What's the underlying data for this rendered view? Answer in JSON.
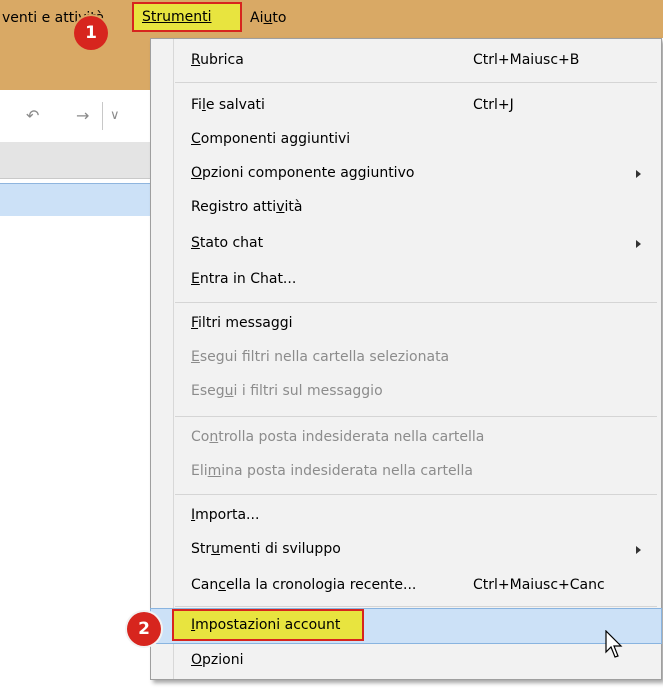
{
  "menubar": {
    "events_label": "venti e attività",
    "tools_label": "Strumenti",
    "help_label_pre": "Ai",
    "help_label_u": "u",
    "help_label_post": "to"
  },
  "toolbar": {
    "icons": [
      "reply-all-icon",
      "forward-icon",
      "chevron-down-icon"
    ]
  },
  "callouts": {
    "step1": "1",
    "step2": "2"
  },
  "menu": {
    "items": [
      {
        "pre": "",
        "u": "R",
        "post": "ubrica",
        "shortcut": "Ctrl+Maiusc+B",
        "submenu": false,
        "disabled": false
      },
      {
        "pre": "Fi",
        "u": "l",
        "post": "e salvati",
        "shortcut": "Ctrl+J",
        "submenu": false,
        "disabled": false
      },
      {
        "pre": "",
        "u": "C",
        "post": "omponenti aggiuntivi",
        "shortcut": "",
        "submenu": false,
        "disabled": false
      },
      {
        "pre": "",
        "u": "O",
        "post": "pzioni componente aggiuntivo",
        "shortcut": "",
        "submenu": true,
        "disabled": false
      },
      {
        "pre": "Registro atti",
        "u": "v",
        "post": "ità",
        "shortcut": "",
        "submenu": false,
        "disabled": false
      },
      {
        "pre": "",
        "u": "S",
        "post": "tato chat",
        "shortcut": "",
        "submenu": true,
        "disabled": false
      },
      {
        "pre": "",
        "u": "E",
        "post": "ntra in Chat...",
        "shortcut": "",
        "submenu": false,
        "disabled": false
      },
      {
        "pre": "",
        "u": "F",
        "post": "iltri messaggi",
        "shortcut": "",
        "submenu": false,
        "disabled": false
      },
      {
        "pre": "",
        "u": "E",
        "post": "segui filtri nella cartella selezionata",
        "shortcut": "",
        "submenu": false,
        "disabled": true
      },
      {
        "pre": "Eseg",
        "u": "u",
        "post": "i i filtri sul messaggio",
        "shortcut": "",
        "submenu": false,
        "disabled": true
      },
      {
        "pre": "Co",
        "u": "n",
        "post": "trolla posta indesiderata nella cartella",
        "shortcut": "",
        "submenu": false,
        "disabled": true
      },
      {
        "pre": "Eli",
        "u": "m",
        "post": "ina posta indesiderata nella cartella",
        "shortcut": "",
        "submenu": false,
        "disabled": true
      },
      {
        "pre": "",
        "u": "I",
        "post": "mporta...",
        "shortcut": "",
        "submenu": false,
        "disabled": false
      },
      {
        "pre": "Str",
        "u": "u",
        "post": "menti di sviluppo",
        "shortcut": "",
        "submenu": true,
        "disabled": false
      },
      {
        "pre": "Can",
        "u": "c",
        "post": "ella la cronologia recente...",
        "shortcut": "Ctrl+Maiusc+Canc",
        "submenu": false,
        "disabled": false
      },
      {
        "pre": "",
        "u": "I",
        "post": "mpostazioni account",
        "shortcut": "",
        "submenu": false,
        "disabled": false
      },
      {
        "pre": "",
        "u": "O",
        "post": "pzioni",
        "shortcut": "",
        "submenu": false,
        "disabled": false
      }
    ]
  }
}
